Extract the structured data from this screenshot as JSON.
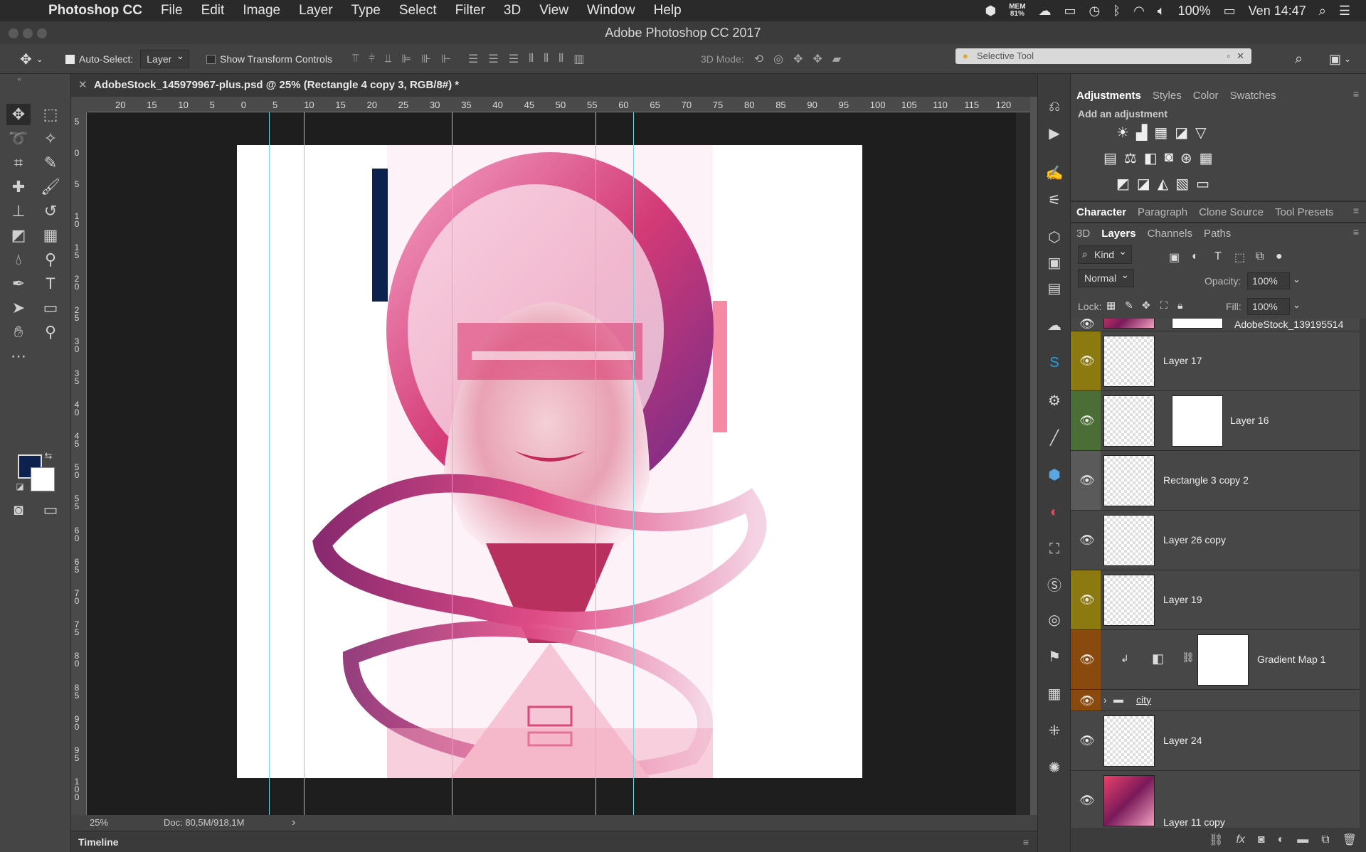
{
  "menubar": {
    "app_name": "Photoshop CC",
    "items": [
      "File",
      "Edit",
      "Image",
      "Layer",
      "Type",
      "Select",
      "Filter",
      "3D",
      "View",
      "Window",
      "Help"
    ],
    "mem_label": "MEM",
    "mem_value": "81%",
    "battery": "100%",
    "clock": "Ven 14:47"
  },
  "window": {
    "title": "Adobe Photoshop CC 2017"
  },
  "options": {
    "auto_select_label": "Auto-Select:",
    "auto_select_value": "Layer",
    "show_transform_label": "Show Transform Controls",
    "mode_3d_label": "3D Mode:",
    "selective_tool_label": "Selective Tool"
  },
  "document": {
    "tab_title": "AdobeStock_145979967-plus.psd @ 25% (Rectangle 4 copy 3, RGB/8#) *",
    "zoom": "25%",
    "doc_info": "Doc: 80,5M/918,1M",
    "timeline_label": "Timeline"
  },
  "ruler": {
    "h_ticks": [
      "20",
      "15",
      "10",
      "5",
      "0",
      "5",
      "10",
      "15",
      "20",
      "25",
      "30",
      "35",
      "40",
      "45",
      "50",
      "55",
      "60",
      "65",
      "70",
      "75",
      "80",
      "85",
      "90",
      "95",
      "100",
      "105",
      "110",
      "115",
      "120"
    ],
    "v_ticks": [
      "5",
      "0",
      "5",
      "1 0",
      "1 5",
      "2 0",
      "2 5",
      "3 0",
      "3 5",
      "4 0",
      "4 5",
      "5 0",
      "5 5",
      "6 0",
      "6 5",
      "7 0",
      "7 5",
      "8 0",
      "8 5",
      "9 0",
      "9 5",
      "1 0 0"
    ]
  },
  "colors": {
    "foreground": "#0c214d",
    "background": "#ffffff",
    "guide": "#6fd9e0"
  },
  "panels": {
    "top_tabs": [
      "Adjustments",
      "Styles",
      "Color",
      "Swatches"
    ],
    "add_adjustment": "Add an adjustment",
    "mid_tabs": [
      "Character",
      "Paragraph",
      "Clone Source",
      "Tool Presets"
    ],
    "layer_tabs": [
      "3D",
      "Layers",
      "Channels",
      "Paths"
    ],
    "filter_kind": "Kind",
    "blend_mode": "Normal",
    "opacity_label": "Opacity:",
    "opacity_value": "100%",
    "lock_label": "Lock:",
    "fill_label": "Fill:",
    "fill_value": "100%"
  },
  "layers": [
    {
      "name": "AdobeStock_139195514",
      "color": "#474747"
    },
    {
      "name": "Layer 17",
      "color": "#8c7a10"
    },
    {
      "name": "Layer 16",
      "color": "#4a6e35"
    },
    {
      "name": "Rectangle 3 copy 2",
      "color": "#5a5a5a"
    },
    {
      "name": "Layer 26 copy",
      "color": "#474747"
    },
    {
      "name": "Layer 19",
      "color": "#8c7a10"
    },
    {
      "name": "Gradient Map 1",
      "color": "#8a4a0e"
    },
    {
      "name": "city",
      "color": "#8a4a0e"
    },
    {
      "name": "Layer 24",
      "color": "#474747"
    },
    {
      "name": "Layer 11 copy",
      "color": "#474747"
    }
  ]
}
